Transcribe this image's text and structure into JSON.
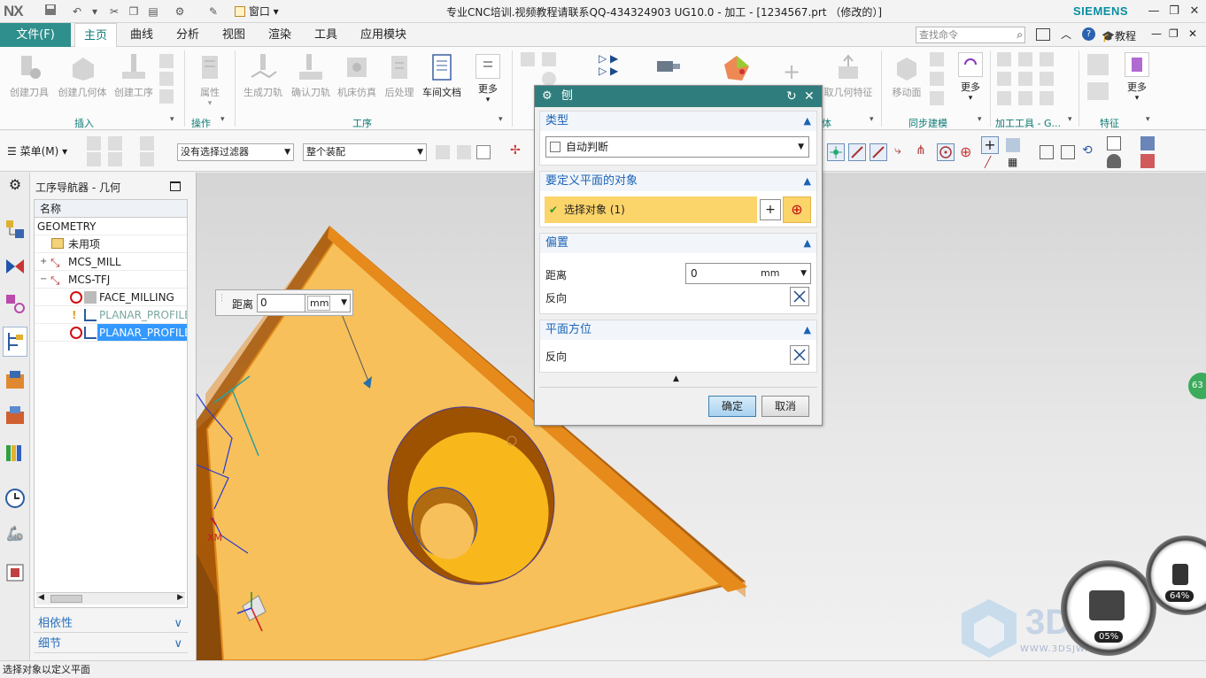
{
  "app": {
    "logo": "NX",
    "window_title": "专业CNC培训.视频教程请联系QQ-434324903 UG10.0 - 加工 - [1234567.prt （修改的）]",
    "brand": "SIEMENS",
    "window_menu": "窗口"
  },
  "menubar": {
    "file": "文件(F)",
    "tabs": [
      "主页",
      "曲线",
      "分析",
      "视图",
      "渲染",
      "工具",
      "应用模块"
    ],
    "active_tab": "主页",
    "search_placeholder": "查找命令",
    "tutorial": "教程"
  },
  "ribbon": {
    "insert_buttons": [
      "创建刀具",
      "创建几何体",
      "创建工序"
    ],
    "insert_group": "插入",
    "ops_buttons": [
      "属性"
    ],
    "ops_group": "操作",
    "proc_buttons": [
      "生成刀轨",
      "确认刀轨",
      "机床仿真",
      "后处理",
      "车间文档"
    ],
    "proc_more": "更多",
    "proc_group": "工序",
    "right_partial_a": "取几何特征",
    "right_partial_b": "体",
    "sync_buttons": [
      "移动面"
    ],
    "sync_more": "更多",
    "sync_group": "同步建模",
    "tools_group": "加工工具 - G...",
    "feat_more": "更多",
    "feat_group": "特征"
  },
  "toolbar2": {
    "menu_label": "菜单(M)",
    "filter": "没有选择过滤器",
    "assembly": "整个装配"
  },
  "navigator": {
    "title": "工序导航器 - 几何",
    "column": "名称",
    "rows": [
      "GEOMETRY",
      "未用项",
      "MCS_MILL",
      "MCS-TFJ",
      "FACE_MILLING",
      "PLANAR_PROFILE",
      "PLANAR_PROFILE"
    ],
    "sections": [
      "相依性",
      "细节"
    ]
  },
  "float_distance": {
    "label": "距离",
    "value": "0",
    "unit": "mm"
  },
  "dialog": {
    "title": "刨",
    "type_section": "类型",
    "type_value": "自动判断",
    "object_section": "要定义平面的对象",
    "select_object": "选择对象 (1)",
    "offset_section": "偏置",
    "distance_label": "距离",
    "distance_value": "0",
    "distance_unit": "mm",
    "reverse_label": "反向",
    "orient_section": "平面方位",
    "orient_reverse": "反向",
    "ok": "确定",
    "cancel": "取消"
  },
  "viewport": {
    "axis_label": "XM",
    "watermark": "3D",
    "watermark_sub": "WWW.3DSJW.COM",
    "gauge_left": "05%",
    "gauge_right": "64%",
    "edge_badge": "63"
  },
  "status": {
    "text": "选择对象以定义平面"
  },
  "colors": {
    "accent_teal": "#2f8f8c",
    "dialog_title": "#2f7d7d",
    "part_face": "#f7c05a",
    "part_side": "#b5650a",
    "highlight": "#fbd46a"
  }
}
